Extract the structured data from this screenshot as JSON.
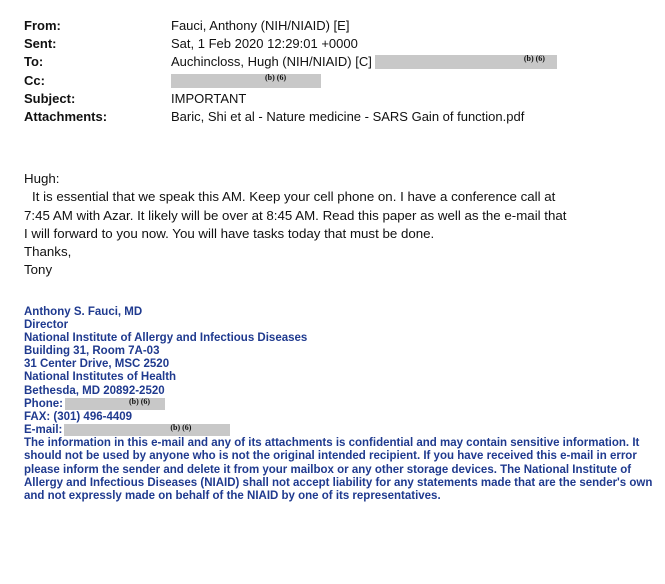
{
  "header": {
    "from_label": "From:",
    "from_value": "Fauci, Anthony (NIH/NIAID) [E]",
    "sent_label": "Sent:",
    "sent_value": "Sat, 1 Feb 2020 12:29:01 +0000",
    "to_label": "To:",
    "to_value": "Auchincloss, Hugh (NIH/NIAID) [C]",
    "to_redaction_code": "(b) (6)",
    "cc_label": "Cc:",
    "cc_redaction_code": "(b) (6)",
    "subject_label": "Subject:",
    "subject_value": "IMPORTANT",
    "attachments_label": "Attachments:",
    "attachments_value": "Baric, Shi et al - Nature medicine - SARS Gain of function.pdf"
  },
  "body": {
    "greeting": "Hugh:",
    "paragraph_line1": "It is essential that we speak this AM.  Keep your cell phone on.   I have a conference call at",
    "paragraph_line2": "7:45 AM with Azar.  It likely will be over at 8:45 AM.  Read this paper as well as the e-mail that",
    "paragraph_line3": "I will forward to you now.  You will have tasks today that must be done.",
    "closing": "Thanks,",
    "signoff": "Tony"
  },
  "signature": {
    "name": "Anthony S. Fauci, MD",
    "title": "Director",
    "institute": "National Institute of Allergy and Infectious Diseases",
    "building": "Building 31, Room 7A-03",
    "street": "31 Center Drive, MSC 2520",
    "org": "National Institutes of Health",
    "city": "Bethesda, MD 20892-2520",
    "phone_label": "Phone:",
    "phone_redaction_code": "(b) (6)",
    "fax": "FAX: (301) 496-4409",
    "email_label": "E-mail:",
    "email_redaction_code": "(b) (6)",
    "disclaimer": "The information in this e-mail and any of its attachments is confidential and may contain sensitive information.  It should not be used by anyone who is not the original intended recipient.  If you have received this e-mail in error please inform the sender and delete it from your mailbox or any other storage devices.  The National Institute of Allergy and Infectious Diseases (NIAID) shall not accept liability for any statements made that are the sender's own and not expressly made on behalf of the NIAID by one of its representatives."
  },
  "colors": {
    "text": "#111111",
    "signature_blue": "#1f3a8f",
    "redaction_gray": "#c8c8c8"
  }
}
